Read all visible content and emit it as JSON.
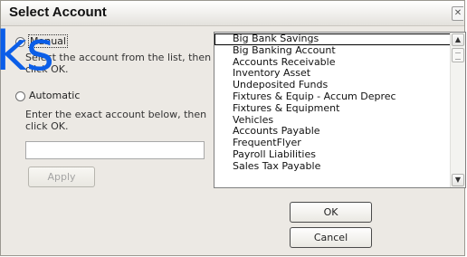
{
  "window": {
    "title": "Select Account",
    "close_glyph": "✕"
  },
  "options": {
    "manual": {
      "label": "Manual",
      "selected": true,
      "description_line1": "Select the account from the list, then",
      "description_line2": "click OK."
    },
    "automatic": {
      "label": "Automatic",
      "selected": false,
      "description_line1": "Enter the exact account below, then",
      "description_line2": "click OK."
    }
  },
  "watermark": "ks",
  "account_input": {
    "value": ""
  },
  "apply_label": "Apply",
  "account_list": {
    "items": [
      "Big Bank Savings",
      "Big Banking Account",
      "Accounts Receivable",
      "Inventory Asset",
      "Undeposited Funds",
      "Fixtures & Equip - Accum Deprec",
      "Fixtures & Equipment",
      "Vehicles",
      "Accounts Payable",
      "FrequentFlyer",
      "Payroll Liabilities",
      "Sales Tax Payable"
    ],
    "selected": "Big Bank Savings",
    "scroll_up": "▲",
    "scroll_down": "▼"
  },
  "buttons": {
    "ok": "OK",
    "cancel": "Cancel"
  },
  "colors": {
    "dialog_bg": "#ece9e4",
    "watermark": "#0b5ee8"
  }
}
